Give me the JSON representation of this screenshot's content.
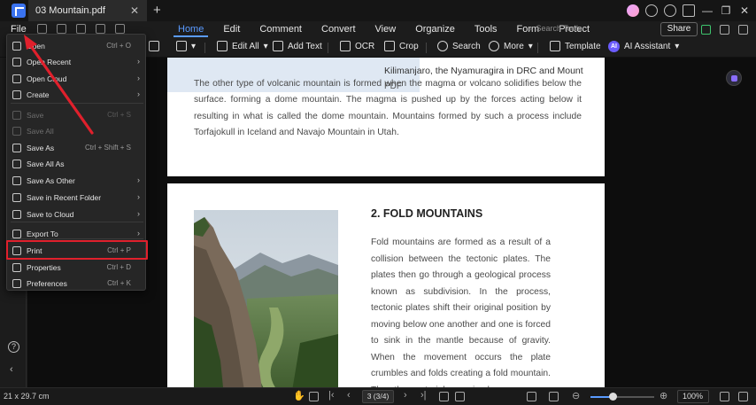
{
  "titlebar": {
    "doc_tab": "03 Mountain.pdf",
    "close_glyph": "✕",
    "new_tab_glyph": "+",
    "win_minimize": "—",
    "win_restore": "❐",
    "win_close": "✕"
  },
  "menubar": {
    "file_label": "File",
    "items": [
      "Home",
      "Edit",
      "Comment",
      "Convert",
      "View",
      "Organize",
      "Tools",
      "Form",
      "Protect"
    ],
    "active": "Home",
    "search_placeholder": "Search Tools",
    "share_label": "Share"
  },
  "toolbar": {
    "edit_all": "Edit All",
    "add_text": "Add Text",
    "ocr": "OCR",
    "crop": "Crop",
    "search": "Search",
    "more": "More",
    "template": "Template",
    "ai_badge": "AI",
    "ai_assistant": "AI Assistant"
  },
  "file_menu": {
    "items": [
      {
        "label": "Open",
        "shortcut": "Ctrl + O",
        "arrow": false,
        "disabled": false
      },
      {
        "label": "Open Recent",
        "shortcut": "",
        "arrow": true,
        "disabled": false
      },
      {
        "label": "Open Cloud",
        "shortcut": "",
        "arrow": true,
        "disabled": false
      },
      {
        "label": "Create",
        "shortcut": "",
        "arrow": true,
        "disabled": false
      },
      {
        "label": "Save",
        "shortcut": "Ctrl + S",
        "arrow": false,
        "disabled": true
      },
      {
        "label": "Save All",
        "shortcut": "",
        "arrow": false,
        "disabled": true
      },
      {
        "label": "Save As",
        "shortcut": "Ctrl + Shift + S",
        "arrow": false,
        "disabled": false
      },
      {
        "label": "Save All As",
        "shortcut": "",
        "arrow": false,
        "disabled": false
      },
      {
        "label": "Save As Other",
        "shortcut": "",
        "arrow": true,
        "disabled": false
      },
      {
        "label": "Save in Recent Folder",
        "shortcut": "",
        "arrow": true,
        "disabled": false
      },
      {
        "label": "Save to Cloud",
        "shortcut": "",
        "arrow": true,
        "disabled": false
      },
      {
        "label": "Export To",
        "shortcut": "",
        "arrow": true,
        "disabled": false
      },
      {
        "label": "Print",
        "shortcut": "Ctrl + P",
        "arrow": false,
        "disabled": false
      },
      {
        "label": "Properties",
        "shortcut": "Ctrl + D",
        "arrow": false,
        "disabled": false
      },
      {
        "label": "Preferences",
        "shortcut": "Ctrl + K",
        "arrow": false,
        "disabled": false
      }
    ],
    "highlighted": "Print"
  },
  "document": {
    "prev_line": "Kilimanjaro, the Nyamuragira in DRC and Mount",
    "pdf_word": "PDF",
    "para1": "The other type of volcanic mountain is formed when the magma or volcano solidifies below the surface. forming a dome mountain. The magma is pushed up by the forces acting below it resulting in what is called the dome mountain. Mountains formed by such a process include Torfajokull in Iceland and Navajo Mountain in Utah.",
    "heading2": "2. FOLD MOUNTAINS",
    "para2": "Fold mountains are formed as a result of a collision between the tectonic plates. The plates then go through a geological process known as subdivision. In the process, tectonic plates shift their original position by moving below one another and one is forced to sink in the mantle because of gravity. When the movement occurs the plate crumbles and folds creating a fold mountain. The other materials remain above"
  },
  "statusbar": {
    "dimensions": "21 x 29.7 cm",
    "page_indicator": "3 (3/4)",
    "zoom_level": "100%",
    "zoom_fraction": 0.35
  },
  "colors": {
    "accent": "#5a9bff",
    "highlight_border": "#e0202c",
    "annotation_arrow": "#e0202c"
  },
  "icons": {
    "app_logo": "pdfelement-logo-icon",
    "help": "help-icon",
    "collapse": "chevron-left-icon"
  }
}
